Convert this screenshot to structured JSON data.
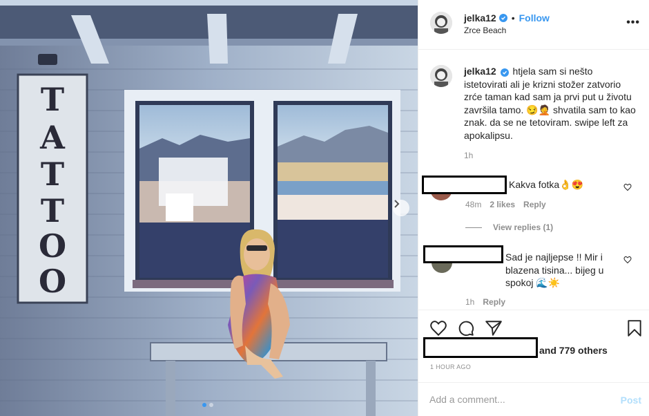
{
  "photo": {
    "sign_letters": [
      "T",
      "A",
      "T",
      "T",
      "O",
      "O"
    ],
    "slide_count": 2,
    "active_slide": 1
  },
  "header": {
    "username": "jelka12",
    "separator": "•",
    "follow_label": "Follow",
    "location": "Zrce Beach",
    "more_label": "•••"
  },
  "caption": {
    "username": "jelka12",
    "text": "htjela sam si nešto istetovirati ali je krizni stožer zatvorio zrće taman kad sam ja prvi put u životu završila tamo. 😏🤦 shvatila sam to kao znak. da se ne tetoviram. swipe left za apokalipsu.",
    "time": "1h"
  },
  "comments": [
    {
      "text": "Kakva fotka👌😍",
      "time": "48m",
      "likes": "2 likes",
      "reply_label": "Reply",
      "view_replies": "View replies (1)"
    },
    {
      "text": "Sad je najljepse !! Mir i blazena tisina... bijeg u spokoj 🌊☀️",
      "time": "1h",
      "reply_label": "Reply"
    }
  ],
  "actions": {
    "likes_suffix": "and 779 others",
    "post_time": "1 HOUR AGO"
  },
  "composer": {
    "placeholder": "Add a comment...",
    "post_label": "Post"
  },
  "colors": {
    "accent": "#3897f0",
    "muted": "#8e8e8e",
    "border": "#efefef"
  }
}
